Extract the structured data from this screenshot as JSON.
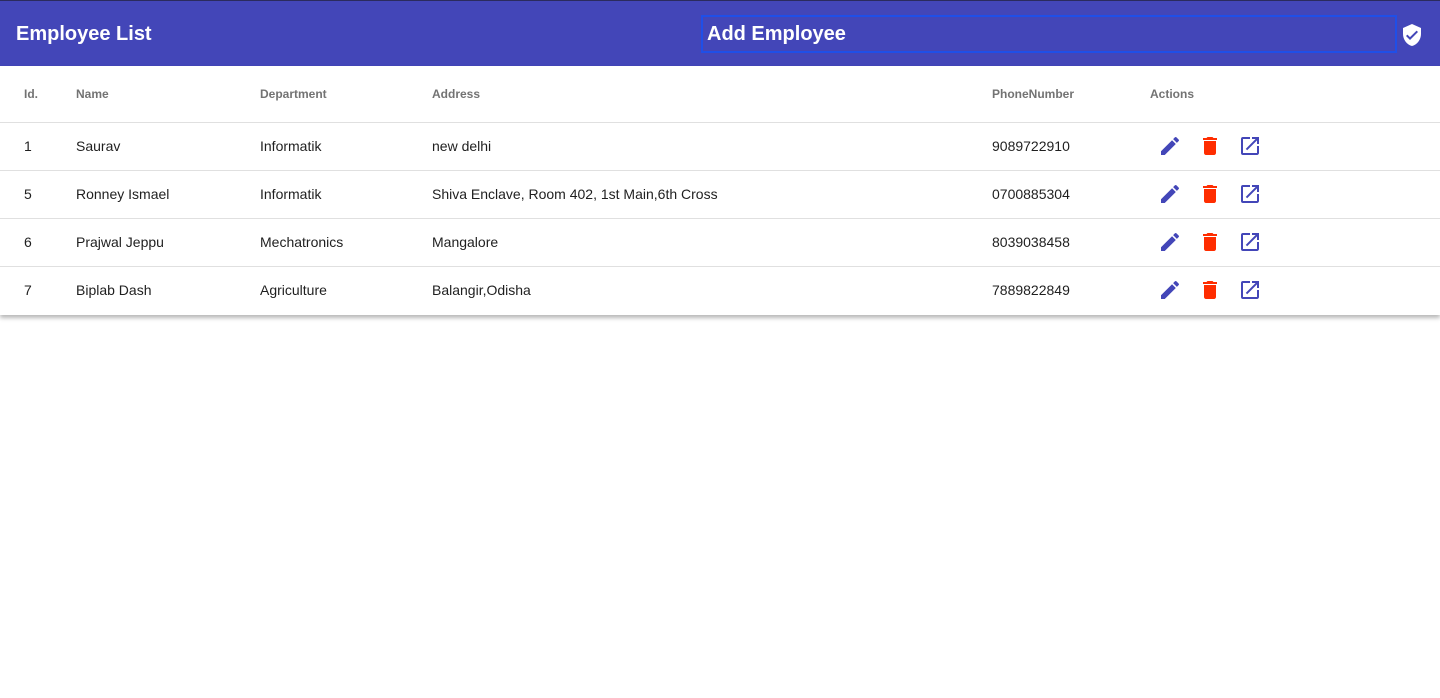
{
  "toolbar": {
    "title": "Employee List",
    "add_button_label": "Add Employee",
    "color": "#4346b8"
  },
  "table": {
    "headers": [
      "Id.",
      "Name",
      "Department",
      "Address",
      "PhoneNumber",
      "Actions"
    ],
    "rows": [
      {
        "id": "1",
        "name": "Saurav",
        "department": "Informatik",
        "address": "new delhi",
        "phone": "9089722910"
      },
      {
        "id": "5",
        "name": "Ronney Ismael",
        "department": "Informatik",
        "address": "Shiva Enclave, Room 402, 1st Main,6th Cross",
        "phone": "0700885304"
      },
      {
        "id": "6",
        "name": "Prajwal Jeppu",
        "department": "Mechatronics",
        "address": "Mangalore",
        "phone": "8039038458"
      },
      {
        "id": "7",
        "name": "Biplab Dash",
        "department": "Agriculture",
        "address": "Balangir,Odisha",
        "phone": "7889822849"
      }
    ],
    "action_icons": [
      "edit-icon",
      "delete-icon",
      "open-in-new-icon"
    ],
    "colors": {
      "edit": "#4346b8",
      "delete": "#ff2d00",
      "open": "#4346b8"
    }
  }
}
